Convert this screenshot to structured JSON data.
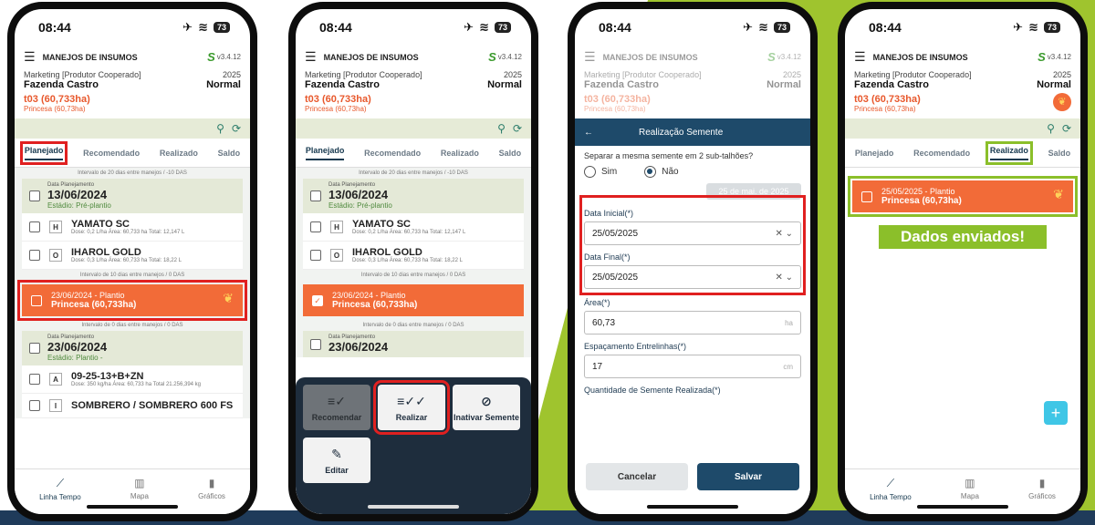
{
  "header": {
    "time": "08:44",
    "battery": "73",
    "app_title": "MANEJOS DE INSUMOS",
    "version": "v3.4.12",
    "farm_sub": "Marketing [Produtor Cooperado]",
    "farm_name": "Fazenda Castro",
    "year": "2025",
    "year_type": "Normal",
    "talhao": "t03 (60,733ha)",
    "talhao_sub": "Princesa (60,73ha)"
  },
  "tabs": [
    "Planejado",
    "Recomendado",
    "Realizado",
    "Saldo"
  ],
  "list": {
    "interval1": "Intervalo de 20 dias entre manejos / -10 DAS",
    "card1_small": "Data Planejamento",
    "card1_date": "13/06/2024",
    "card1_stage": "Estádio: Pré-plantio",
    "p1_badge": "H",
    "p1_name": "YAMATO SC",
    "p1_detail": "Dose: 0,2 L/ha   Área: 60,733 ha   Total: 12,147 L",
    "p2_badge": "O",
    "p2_name": "IHAROL GOLD",
    "p2_detail": "Dose: 0,3 L/ha   Área: 60,733 ha   Total: 18,22 L",
    "interval2": "Intervalo de 10 dias entre manejos / 0 DAS",
    "orange_line1": "23/06/2024 - Plantio",
    "orange_line2": "Princesa (60,733ha)",
    "interval3": "Intervalo de 0 dias entre manejos / 0 DAS",
    "card2_small": "Data Planejamento",
    "card2_date": "23/06/2024",
    "card2_stage": "Estádio: Plantio -",
    "p3_badge": "A",
    "p3_name": "09-25-13+B+ZN",
    "p3_detail": "Dose: 350 kg/ha   Área: 60,733 ha   Total 21.256,394 kg",
    "p4_badge": "I",
    "p4_name": "SOMBRERO / SOMBRERO 600 FS"
  },
  "nav": {
    "timeline": "Linha Tempo",
    "map": "Mapa",
    "charts": "Gráficos"
  },
  "actions": {
    "recommend": "Recomendar",
    "realize": "Realizar",
    "inactivate": "Inativar Semente",
    "edit": "Editar"
  },
  "modal": {
    "title": "Realização Semente",
    "question": "Separar a mesma semente em 2 sub-talhões?",
    "yes": "Sim",
    "no": "Não",
    "date_chip": "25 de mai. de 2025",
    "start_label": "Data Inicial(*)",
    "start_value": "25/05/2025",
    "end_label": "Data Final(*)",
    "end_value": "25/05/2025",
    "area_label": "Área(*)",
    "area_value": "60,73",
    "area_unit": "ha",
    "spacing_label": "Espaçamento Entrelinhas(*)",
    "spacing_value": "17",
    "spacing_unit": "cm",
    "qty_label": "Quantidade de Semente Realizada(*)",
    "cancel": "Cancelar",
    "save": "Salvar"
  },
  "done": {
    "line1": "25/05/2025 - Plantio",
    "line2": "Princesa (60,73ha)",
    "sent": "Dados enviados!"
  }
}
